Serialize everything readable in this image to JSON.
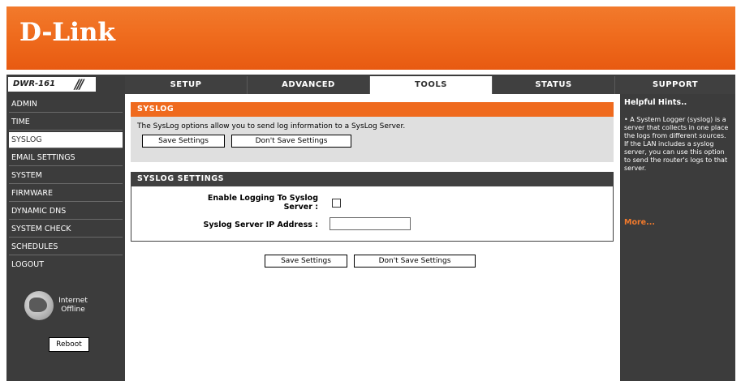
{
  "header": {
    "logo": "D-Link",
    "model": "DWR-161"
  },
  "tabs": [
    {
      "label": "SETUP",
      "active": false
    },
    {
      "label": "ADVANCED",
      "active": false
    },
    {
      "label": "TOOLS",
      "active": true
    },
    {
      "label": "STATUS",
      "active": false
    },
    {
      "label": "SUPPORT",
      "active": false
    }
  ],
  "sidebar": {
    "items": [
      {
        "label": "ADMIN",
        "active": false
      },
      {
        "label": "TIME",
        "active": false
      },
      {
        "label": "SYSLOG",
        "active": true
      },
      {
        "label": "EMAIL SETTINGS",
        "active": false
      },
      {
        "label": "SYSTEM",
        "active": false
      },
      {
        "label": "FIRMWARE",
        "active": false
      },
      {
        "label": "DYNAMIC DNS",
        "active": false
      },
      {
        "label": "SYSTEM CHECK",
        "active": false
      },
      {
        "label": "SCHEDULES",
        "active": false
      },
      {
        "label": "LOGOUT",
        "active": false
      }
    ],
    "internet_status_line1": "Internet",
    "internet_status_line2": "Offline",
    "reboot_label": "Reboot"
  },
  "syslog": {
    "title": "SYSLOG",
    "description": "The SysLog options allow you to send log information to a SysLog Server.",
    "save_label": "Save Settings",
    "dont_save_label": "Don't Save Settings"
  },
  "settings": {
    "title": "SYSLOG SETTINGS",
    "enable_label_line1": "Enable Logging To Syslog",
    "enable_label_line2": "Server :",
    "enable_checked": false,
    "ip_label": "Syslog Server IP Address :",
    "ip_value": ""
  },
  "bottom_buttons": {
    "save_label": "Save Settings",
    "dont_save_label": "Don't Save Settings"
  },
  "support": {
    "title": "Helpful Hints..",
    "hint": "• A System Logger (syslog) is a server that collects in one place the logs from different sources. If the LAN includes a syslog server, you can use this option to send the router's logs to that server.",
    "more_label": "More..."
  },
  "colors": {
    "accent": "#ef6a1e",
    "nav_bg": "#3c3c3c",
    "panel_bg": "#dfdfdf"
  }
}
